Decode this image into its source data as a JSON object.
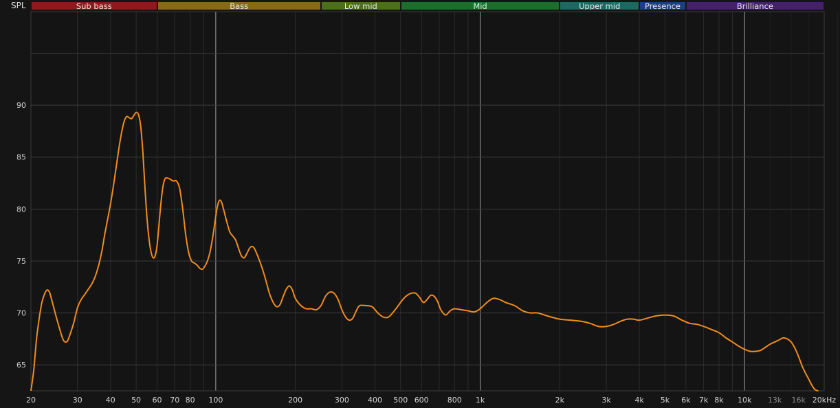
{
  "app": {
    "spl_label": "SPL"
  },
  "bands": [
    {
      "label": "Sub bass",
      "from": 20,
      "to": 60,
      "color": "#8e1a1d"
    },
    {
      "label": "Bass",
      "from": 60,
      "to": 250,
      "color": "#866a1a"
    },
    {
      "label": "Low mid",
      "from": 250,
      "to": 500,
      "color": "#4c6f1a"
    },
    {
      "label": "Mid",
      "from": 500,
      "to": 2000,
      "color": "#1a6f2a"
    },
    {
      "label": "Upper mid",
      "from": 2000,
      "to": 4000,
      "color": "#1a6a62"
    },
    {
      "label": "Presence",
      "from": 4000,
      "to": 6000,
      "color": "#1a3f86"
    },
    {
      "label": "Brilliance",
      "from": 6000,
      "to": 20000,
      "color": "#44206e"
    }
  ],
  "chart_data": {
    "type": "line",
    "x_scale": "log",
    "xlim": [
      20,
      20000
    ],
    "ylim": [
      62.5,
      99
    ],
    "grid": true,
    "x_tick_labels": [
      {
        "x": 20,
        "label": "20"
      },
      {
        "x": 30,
        "label": "30"
      },
      {
        "x": 40,
        "label": "40"
      },
      {
        "x": 50,
        "label": "50"
      },
      {
        "x": 60,
        "label": "60"
      },
      {
        "x": 70,
        "label": "70"
      },
      {
        "x": 80,
        "label": "80"
      },
      {
        "x": 100,
        "label": "100"
      },
      {
        "x": 200,
        "label": "200"
      },
      {
        "x": 300,
        "label": "300"
      },
      {
        "x": 400,
        "label": "400"
      },
      {
        "x": 500,
        "label": "500"
      },
      {
        "x": 600,
        "label": "600"
      },
      {
        "x": 800,
        "label": "800"
      },
      {
        "x": 1000,
        "label": "1k"
      },
      {
        "x": 2000,
        "label": "2k"
      },
      {
        "x": 3000,
        "label": "3k"
      },
      {
        "x": 4000,
        "label": "4k"
      },
      {
        "x": 5000,
        "label": "5k"
      },
      {
        "x": 6000,
        "label": "6k"
      },
      {
        "x": 7000,
        "label": "7k"
      },
      {
        "x": 8000,
        "label": "8k"
      },
      {
        "x": 10000,
        "label": "10k"
      },
      {
        "x": 13000,
        "label": "13k",
        "dim": true
      },
      {
        "x": 16000,
        "label": "16k",
        "dim": true
      },
      {
        "x": 20000,
        "label": "20kHz"
      }
    ],
    "y_tick_labels": [
      {
        "y": 65,
        "label": "65"
      },
      {
        "y": 70,
        "label": "70"
      },
      {
        "y": 75,
        "label": "75"
      },
      {
        "y": 80,
        "label": "80"
      },
      {
        "y": 85,
        "label": "85"
      },
      {
        "y": 90,
        "label": "90"
      }
    ],
    "series": [
      {
        "color": "#f08c1e",
        "points": [
          [
            20,
            62.5
          ],
          [
            20.5,
            64.5
          ],
          [
            21,
            67.5
          ],
          [
            21.5,
            69.5
          ],
          [
            22,
            71.0
          ],
          [
            22.5,
            71.8
          ],
          [
            23,
            72.2
          ],
          [
            23.5,
            72.0
          ],
          [
            24,
            71.2
          ],
          [
            25,
            69.5
          ],
          [
            26,
            68.0
          ],
          [
            26.5,
            67.4
          ],
          [
            27,
            67.2
          ],
          [
            27.5,
            67.3
          ],
          [
            28,
            67.8
          ],
          [
            29,
            69.0
          ],
          [
            30,
            70.5
          ],
          [
            31,
            71.3
          ],
          [
            32,
            71.8
          ],
          [
            33,
            72.3
          ],
          [
            34,
            72.8
          ],
          [
            35,
            73.5
          ],
          [
            36,
            74.5
          ],
          [
            37,
            75.8
          ],
          [
            38,
            77.5
          ],
          [
            39,
            79.0
          ],
          [
            40,
            80.5
          ],
          [
            41,
            82.2
          ],
          [
            42,
            84.0
          ],
          [
            43,
            85.8
          ],
          [
            44,
            87.3
          ],
          [
            45,
            88.4
          ],
          [
            46,
            88.9
          ],
          [
            47,
            88.8
          ],
          [
            48,
            88.7
          ],
          [
            49,
            89.0
          ],
          [
            50,
            89.3
          ],
          [
            51,
            89.1
          ],
          [
            52,
            88.0
          ],
          [
            53,
            85.5
          ],
          [
            54,
            82.0
          ],
          [
            55,
            79.0
          ],
          [
            56,
            77.0
          ],
          [
            57,
            75.8
          ],
          [
            58,
            75.3
          ],
          [
            59,
            75.5
          ],
          [
            60,
            76.5
          ],
          [
            61,
            78.5
          ],
          [
            62,
            80.5
          ],
          [
            63,
            82.0
          ],
          [
            64,
            82.8
          ],
          [
            65,
            83.0
          ],
          [
            67,
            82.9
          ],
          [
            69,
            82.7
          ],
          [
            71,
            82.7
          ],
          [
            73,
            82.0
          ],
          [
            75,
            80.0
          ],
          [
            77,
            77.5
          ],
          [
            79,
            75.8
          ],
          [
            81,
            75.0
          ],
          [
            83,
            74.8
          ],
          [
            85,
            74.6
          ],
          [
            87,
            74.3
          ],
          [
            89,
            74.2
          ],
          [
            91,
            74.5
          ],
          [
            93,
            75.0
          ],
          [
            95,
            75.8
          ],
          [
            97,
            77.0
          ],
          [
            99,
            78.5
          ],
          [
            101,
            80.0
          ],
          [
            103,
            80.8
          ],
          [
            105,
            80.7
          ],
          [
            107,
            80.0
          ],
          [
            110,
            78.8
          ],
          [
            113,
            77.8
          ],
          [
            116,
            77.4
          ],
          [
            119,
            77.0
          ],
          [
            122,
            76.2
          ],
          [
            125,
            75.5
          ],
          [
            128,
            75.3
          ],
          [
            131,
            75.7
          ],
          [
            134,
            76.2
          ],
          [
            137,
            76.4
          ],
          [
            140,
            76.2
          ],
          [
            144,
            75.5
          ],
          [
            148,
            74.7
          ],
          [
            152,
            73.8
          ],
          [
            156,
            72.8
          ],
          [
            160,
            71.8
          ],
          [
            165,
            71.0
          ],
          [
            170,
            70.6
          ],
          [
            175,
            70.8
          ],
          [
            180,
            71.6
          ],
          [
            185,
            72.3
          ],
          [
            190,
            72.6
          ],
          [
            195,
            72.2
          ],
          [
            200,
            71.4
          ],
          [
            210,
            70.7
          ],
          [
            220,
            70.4
          ],
          [
            230,
            70.4
          ],
          [
            240,
            70.3
          ],
          [
            250,
            70.7
          ],
          [
            260,
            71.6
          ],
          [
            270,
            72.0
          ],
          [
            280,
            71.9
          ],
          [
            290,
            71.3
          ],
          [
            300,
            70.3
          ],
          [
            310,
            69.6
          ],
          [
            320,
            69.3
          ],
          [
            330,
            69.5
          ],
          [
            340,
            70.2
          ],
          [
            350,
            70.7
          ],
          [
            370,
            70.7
          ],
          [
            390,
            70.6
          ],
          [
            410,
            70.0
          ],
          [
            430,
            69.6
          ],
          [
            450,
            69.6
          ],
          [
            470,
            70.1
          ],
          [
            490,
            70.7
          ],
          [
            510,
            71.3
          ],
          [
            530,
            71.7
          ],
          [
            550,
            71.9
          ],
          [
            570,
            71.9
          ],
          [
            590,
            71.5
          ],
          [
            610,
            71.0
          ],
          [
            630,
            71.3
          ],
          [
            650,
            71.7
          ],
          [
            670,
            71.6
          ],
          [
            690,
            71.1
          ],
          [
            710,
            70.3
          ],
          [
            740,
            69.8
          ],
          [
            770,
            70.2
          ],
          [
            800,
            70.4
          ],
          [
            850,
            70.3
          ],
          [
            900,
            70.2
          ],
          [
            950,
            70.1
          ],
          [
            1000,
            70.4
          ],
          [
            1060,
            71.0
          ],
          [
            1120,
            71.4
          ],
          [
            1180,
            71.3
          ],
          [
            1250,
            71.0
          ],
          [
            1350,
            70.7
          ],
          [
            1450,
            70.2
          ],
          [
            1550,
            70.0
          ],
          [
            1650,
            70.0
          ],
          [
            1800,
            69.7
          ],
          [
            2000,
            69.4
          ],
          [
            2200,
            69.3
          ],
          [
            2400,
            69.2
          ],
          [
            2600,
            69.0
          ],
          [
            2800,
            68.7
          ],
          [
            3000,
            68.7
          ],
          [
            3200,
            68.9
          ],
          [
            3400,
            69.2
          ],
          [
            3600,
            69.4
          ],
          [
            3800,
            69.4
          ],
          [
            4000,
            69.3
          ],
          [
            4300,
            69.5
          ],
          [
            4600,
            69.7
          ],
          [
            5000,
            69.8
          ],
          [
            5400,
            69.7
          ],
          [
            5800,
            69.3
          ],
          [
            6200,
            69.0
          ],
          [
            6600,
            68.9
          ],
          [
            7000,
            68.7
          ],
          [
            7500,
            68.4
          ],
          [
            8000,
            68.1
          ],
          [
            8500,
            67.6
          ],
          [
            9000,
            67.2
          ],
          [
            9500,
            66.8
          ],
          [
            10000,
            66.5
          ],
          [
            10500,
            66.3
          ],
          [
            11000,
            66.3
          ],
          [
            11500,
            66.4
          ],
          [
            12000,
            66.7
          ],
          [
            12500,
            67.0
          ],
          [
            13000,
            67.2
          ],
          [
            13500,
            67.4
          ],
          [
            14000,
            67.6
          ],
          [
            14500,
            67.5
          ],
          [
            15000,
            67.2
          ],
          [
            15500,
            66.6
          ],
          [
            16000,
            65.8
          ],
          [
            16500,
            64.9
          ],
          [
            17000,
            64.2
          ],
          [
            17500,
            63.6
          ],
          [
            18000,
            63.0
          ],
          [
            18500,
            62.6
          ],
          [
            19000,
            62.5
          ]
        ]
      }
    ]
  }
}
